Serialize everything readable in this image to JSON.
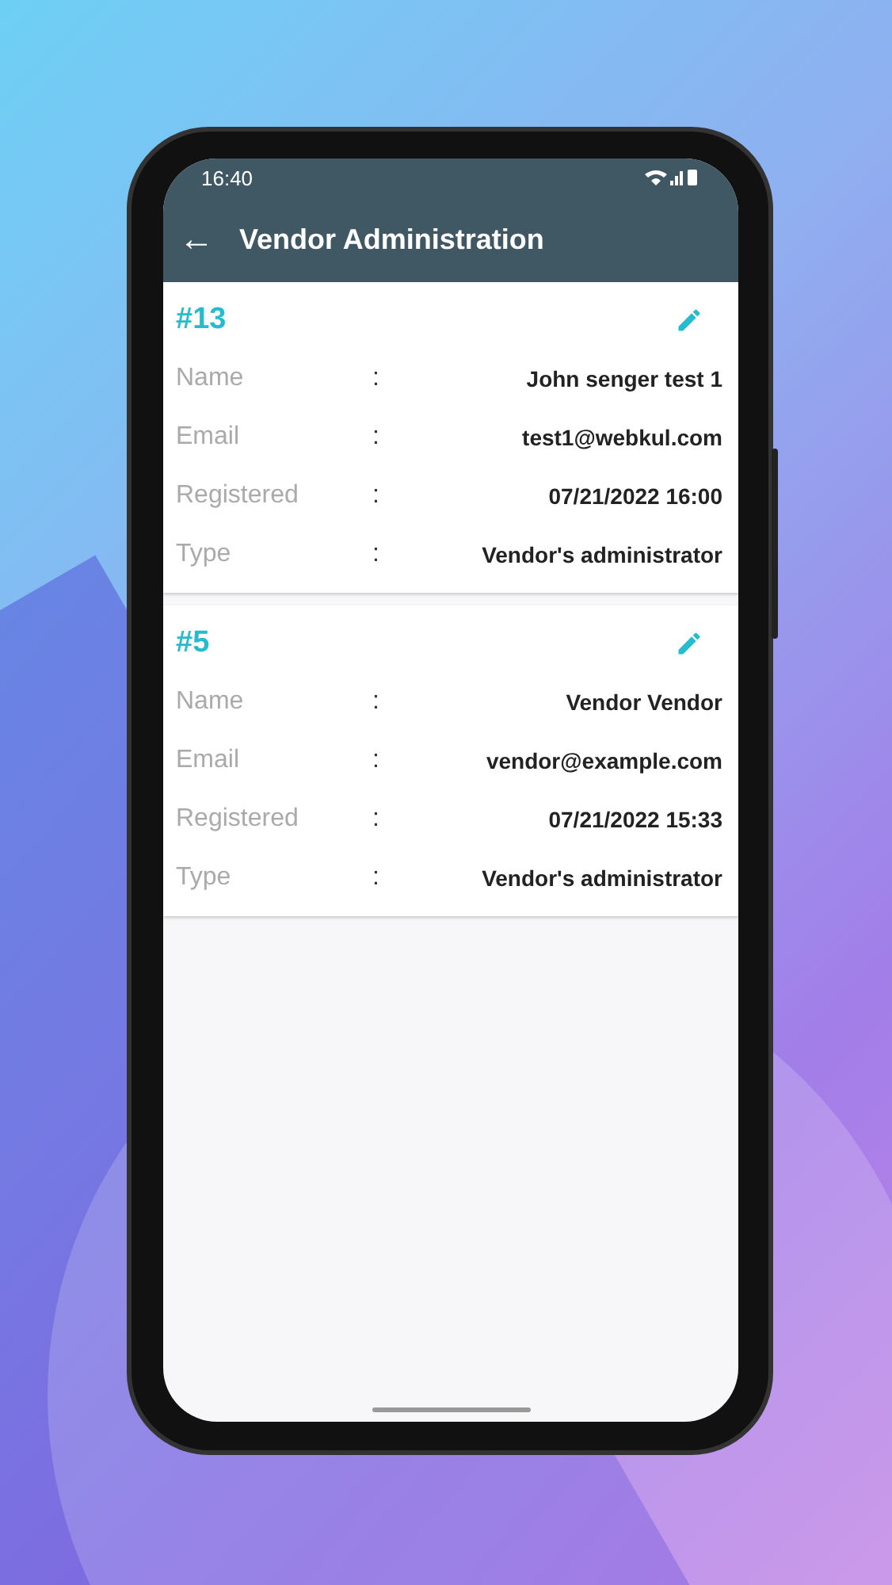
{
  "status_bar": {
    "time": "16:40"
  },
  "app_bar": {
    "back": "←",
    "title": "Vendor Administration"
  },
  "vendors": [
    {
      "id": "#13",
      "fields": [
        {
          "label": "Name",
          "colon": ":",
          "value": "John senger test 1"
        },
        {
          "label": "Email",
          "colon": ":",
          "value": "test1@webkul.com"
        },
        {
          "label": "Registered",
          "colon": ":",
          "value": "07/21/2022 16:00"
        },
        {
          "label": "Type",
          "colon": ":",
          "value": "Vendor's administrator"
        }
      ]
    },
    {
      "id": "#5",
      "fields": [
        {
          "label": "Name",
          "colon": ":",
          "value": "Vendor Vendor"
        },
        {
          "label": "Email",
          "colon": ":",
          "value": "vendor@example.com"
        },
        {
          "label": "Registered",
          "colon": ":",
          "value": "07/21/2022 15:33"
        },
        {
          "label": "Type",
          "colon": ":",
          "value": "Vendor's administrator"
        }
      ]
    }
  ]
}
